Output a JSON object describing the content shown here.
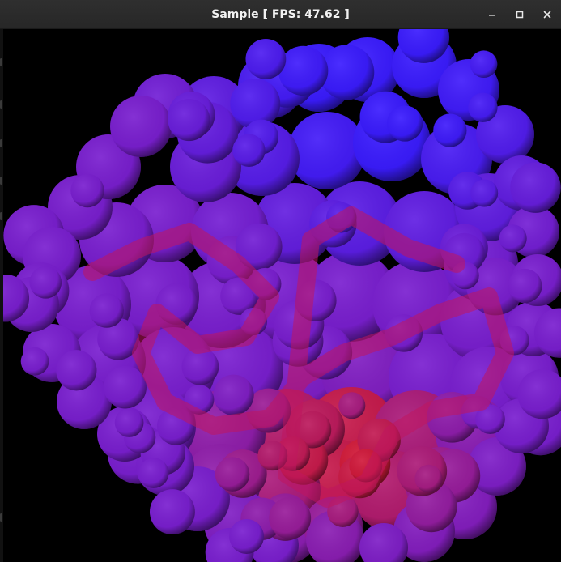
{
  "window": {
    "title": "Sample [ FPS: 47.62 ]",
    "controls": {
      "minimize_icon": "minimize-icon",
      "maximize_icon": "maximize-icon",
      "close_icon": "close-icon"
    }
  },
  "viewport": {
    "background": "#000000",
    "colors": {
      "surface_blue": "#3b1cff",
      "surface_violet": "#7a1fd0",
      "surface_magenta": "#c0155f",
      "surface_red": "#d81a30",
      "wire_dark": "#0a0420"
    }
  }
}
